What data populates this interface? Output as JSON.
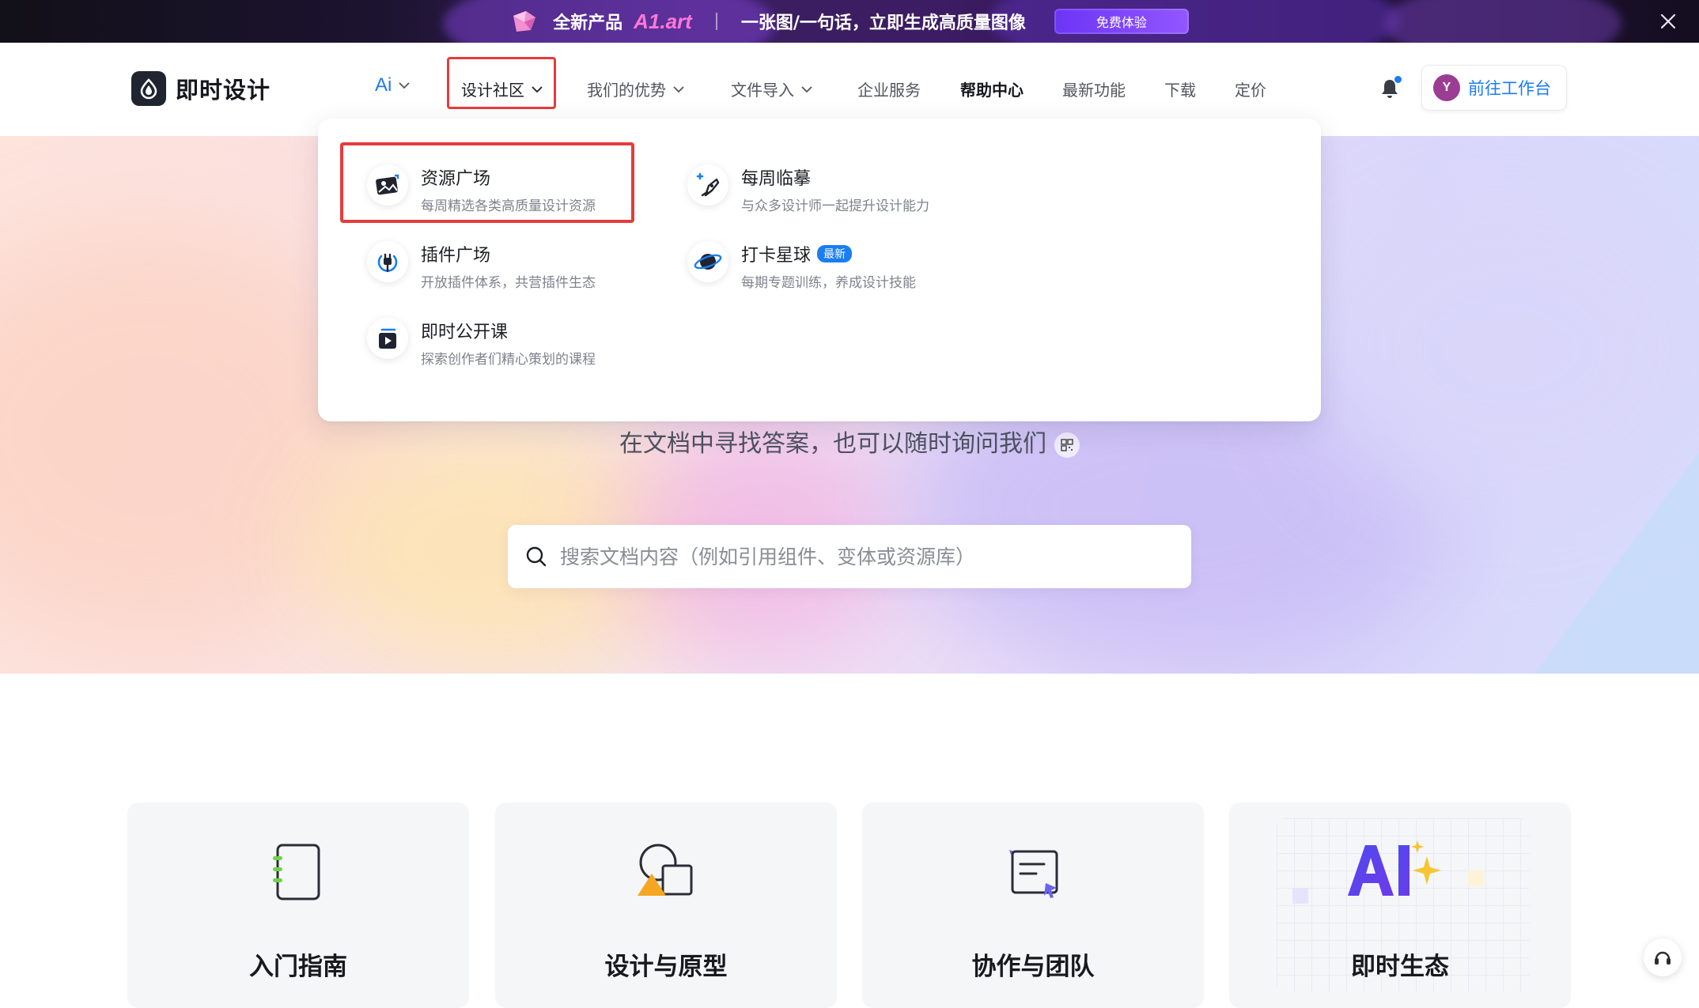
{
  "promo": {
    "prefix": "全新产品",
    "brand": "A1.art",
    "slogan": "一张图/一句话，立即生成高质量图像",
    "cta": "免费体验"
  },
  "header": {
    "logo_text": "即时设计",
    "nav": [
      {
        "label": "Ai",
        "has_chevron": true
      },
      {
        "label": "设计社区",
        "has_chevron": true,
        "active": true
      },
      {
        "label": "我们的优势",
        "has_chevron": true
      },
      {
        "label": "文件导入",
        "has_chevron": true
      },
      {
        "label": "企业服务",
        "has_chevron": false
      },
      {
        "label": "帮助中心",
        "has_chevron": false,
        "bold": true
      },
      {
        "label": "最新功能",
        "has_chevron": false
      },
      {
        "label": "下载",
        "has_chevron": false
      },
      {
        "label": "定价",
        "has_chevron": false
      }
    ],
    "avatar_initial": "Y",
    "workspace_label": "前往工作台"
  },
  "dropdown": {
    "items": [
      {
        "title": "资源广场",
        "desc": "每周精选各类高质量设计资源",
        "icon": "image-gallery-icon",
        "selected": true
      },
      {
        "title": "每周临摹",
        "desc": "与众多设计师一起提升设计能力",
        "icon": "pen-plus-icon"
      },
      {
        "title": "插件广场",
        "desc": "开放插件体系，共营插件生态",
        "icon": "plug-icon"
      },
      {
        "title": "打卡星球",
        "desc": "每期专题训练，养成设计技能",
        "icon": "planet-icon",
        "badge": "最新"
      },
      {
        "title": "即时公开课",
        "desc": "探索创作者们精心策划的课程",
        "icon": "video-play-icon"
      }
    ]
  },
  "hero": {
    "subtitle": "在文档中寻找答案，也可以随时询问我们",
    "search_placeholder": "搜索文档内容（例如引用组件、变体或资源库）"
  },
  "cards": [
    {
      "title": "入门指南",
      "icon": "notebook-icon"
    },
    {
      "title": "设计与原型",
      "icon": "shapes-icon"
    },
    {
      "title": "协作与团队",
      "icon": "collaboration-doc-icon"
    },
    {
      "title": "即时生态",
      "icon": "ai-sparkle-icon"
    }
  ],
  "colors": {
    "accent": "#1a7df2",
    "highlight_border": "#e63b3b",
    "promo_brand": "#ff79d3",
    "avatar": "#9b3d93"
  }
}
